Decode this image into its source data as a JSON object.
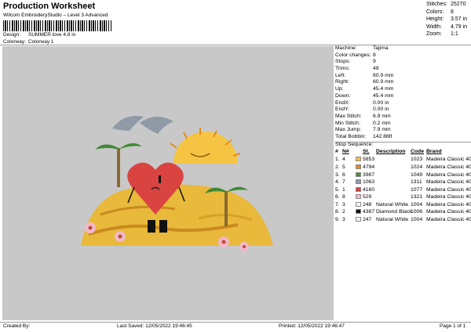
{
  "header": {
    "title": "Production Worksheet",
    "subtitle": "Wilcom EmbroideryStudio – Level 3 Advanced",
    "design_label": "Design:",
    "design_value": "SUMMER love 4,8 in",
    "colorway_label": "Colorway:",
    "colorway_value": "Colorway 1"
  },
  "stats": [
    {
      "k": "Stitches:",
      "v": "25270"
    },
    {
      "k": "Colors:",
      "v": "8"
    },
    {
      "k": "Height:",
      "v": "3.57 in"
    },
    {
      "k": "Width:",
      "v": "4.79 in"
    },
    {
      "k": "Zoom:",
      "v": "1:1"
    }
  ],
  "info": [
    {
      "k": "Machine:",
      "v": "Tajima"
    },
    {
      "k": "Color changes:",
      "v": "8"
    },
    {
      "k": "Stops:",
      "v": "9"
    },
    {
      "k": "Trims:",
      "v": "49"
    },
    {
      "k": "Left:",
      "v": "60.9 mm"
    },
    {
      "k": "Right:",
      "v": "60.9 mm"
    },
    {
      "k": "Up:",
      "v": "45.4 mm"
    },
    {
      "k": "Down:",
      "v": "45.4 mm"
    },
    {
      "k": "EndX:",
      "v": "0.00 in"
    },
    {
      "k": "EndY:",
      "v": "0.00 in"
    },
    {
      "k": "Max Stitch:",
      "v": "6.9 mm"
    },
    {
      "k": "Min Stitch:",
      "v": "0.2 mm"
    },
    {
      "k": "Max Jump:",
      "v": "7.9 mm"
    },
    {
      "k": "Total Bobbin:",
      "v": "142.86ft"
    }
  ],
  "stop_sequence": {
    "title": "Stop Sequence:",
    "headers": {
      "num": "#",
      "n": "N#",
      "st": "St.",
      "desc": "Description",
      "code": "Code",
      "brand": "Brand"
    },
    "rows": [
      {
        "num": "1.",
        "n": "4",
        "color": "#f2c24e",
        "st": "5853",
        "desc": "",
        "code": "1023",
        "brand": "Madeira Classic 40"
      },
      {
        "num": "2.",
        "n": "5",
        "color": "#e88a18",
        "st": "4794",
        "desc": "",
        "code": "1024",
        "brand": "Madeira Classic 40"
      },
      {
        "num": "3.",
        "n": "6",
        "color": "#4f8a3a",
        "st": "3987",
        "desc": "",
        "code": "1049",
        "brand": "Madeira Classic 40"
      },
      {
        "num": "4.",
        "n": "7",
        "color": "#8f9aa6",
        "st": "1063",
        "desc": "",
        "code": "1311",
        "brand": "Madeira Classic 40"
      },
      {
        "num": "5.",
        "n": "1",
        "color": "#d4403c",
        "st": "4160",
        "desc": "",
        "code": "1077",
        "brand": "Madeira Classic 40"
      },
      {
        "num": "6.",
        "n": "8",
        "color": "#f0b8c8",
        "st": "529",
        "desc": "",
        "code": "1321",
        "brand": "Madeira Classic 40"
      },
      {
        "num": "7.",
        "n": "3",
        "color": "#f4f4f4",
        "st": "248",
        "desc": "Natural White",
        "code": "1004",
        "brand": "Madeira Classic 40"
      },
      {
        "num": "8.",
        "n": "2",
        "color": "#111111",
        "st": "4387",
        "desc": "Diamond Black",
        "code": "1006",
        "brand": "Madeira Classic 40"
      },
      {
        "num": "9.",
        "n": "3",
        "color": "#f4f4f4",
        "st": "247",
        "desc": "Natural White",
        "code": "1004",
        "brand": "Madeira Classic 40"
      }
    ]
  },
  "footer": {
    "created_by": "Created By:",
    "last_saved": "Last Saved: 12/05/2022 19:46:45",
    "printed": "Printed: 12/05/2022 19:46:47",
    "page": "Page 1 of 1"
  },
  "colors": {
    "canvas_bg": "#c8c8c8",
    "sand": "#e8b93a",
    "sand_dark": "#c98a1e",
    "palm": "#3f8a35",
    "heart": "#d94441",
    "dolphin": "#8f9aa6",
    "sun": "#f5c443",
    "flower": "#f0b8c8"
  }
}
